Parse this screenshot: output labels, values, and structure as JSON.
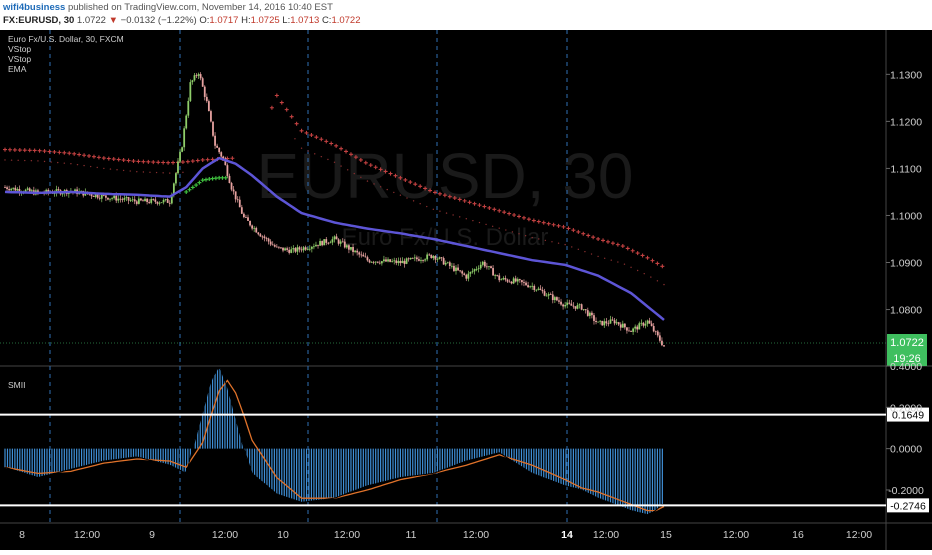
{
  "header": {
    "user": "wifi4business",
    "published": "published on TradingView.com, November 14, 2016 10:40 EST",
    "symbol": "FX:EURUSD, 30",
    "last": "1.0722",
    "arrow": "▼",
    "change": "−0.0132 (−1.22%)",
    "open_label": "O:",
    "open": "1.0717",
    "high_label": "H:",
    "high": "1.0725",
    "low_label": "L:",
    "low": "1.0713",
    "close_label": "C:",
    "close": "1.0722"
  },
  "legend": {
    "title": "Euro Fx/U.S. Dollar, 30, FXCM",
    "items": [
      "VStop",
      "VStop",
      "EMA"
    ]
  },
  "oscillator": {
    "name": "SMII"
  },
  "watermark": {
    "symbol": "EURUSD, 30",
    "desc": "Euro Fx/U.S. Dollar"
  },
  "colors": {
    "background": "#000000",
    "up_candle": "#8fce6a",
    "down_candle": "#e7a2a0",
    "ema": "#5d55d6",
    "vstop_red": "#c24141",
    "vstop_green": "#3fbf3f",
    "histogram": "#3f8fd6",
    "signal": "#e0722a",
    "current_price_bg": "#3fbf5f"
  },
  "chart_data": [
    {
      "type": "line",
      "name": "main-price",
      "x_ticks": [
        "8",
        "12:00",
        "9",
        "12:00",
        "12:00",
        "10",
        "12:00",
        "11",
        "12:00",
        "14",
        "12:00",
        "15",
        "12:00",
        "16",
        "12:00"
      ],
      "y_ticks": [
        "1.1300",
        "1.1200",
        "1.1100",
        "1.1000",
        "1.0900",
        "1.0800"
      ],
      "ylim": [
        1.068,
        1.139
      ],
      "current_price": "1.0722",
      "countdown": "19:26",
      "grid": false,
      "series": [
        {
          "name": "EMA",
          "x": [
            0,
            8,
            16,
            24,
            32,
            40,
            44,
            48,
            52,
            56,
            60,
            66,
            72,
            80,
            88,
            96,
            104,
            112,
            120,
            128,
            136,
            144,
            152,
            160
          ],
          "values": [
            1.105,
            1.1048,
            1.105,
            1.1046,
            1.1044,
            1.104,
            1.106,
            1.11,
            1.1122,
            1.111,
            1.1085,
            1.104,
            1.1005,
            1.0985,
            1.0972,
            1.0962,
            1.095,
            1.0935,
            1.092,
            1.0905,
            1.0895,
            1.0872,
            1.0835,
            1.0778
          ]
        },
        {
          "name": "price",
          "x": [
            0,
            8,
            16,
            24,
            32,
            40,
            43,
            45,
            47,
            49,
            51,
            53,
            55,
            58,
            62,
            66,
            70,
            74,
            80,
            88,
            96,
            104,
            112,
            116,
            120,
            124,
            128,
            132,
            136,
            140,
            144,
            148,
            152,
            156,
            160
          ],
          "values": [
            1.106,
            1.1048,
            1.1052,
            1.104,
            1.103,
            1.103,
            1.115,
            1.128,
            1.1305,
            1.124,
            1.115,
            1.112,
            1.106,
            1.0995,
            1.096,
            1.093,
            1.0925,
            1.0935,
            1.095,
            1.0905,
            1.09,
            1.0915,
            1.087,
            1.09,
            1.0865,
            1.086,
            1.085,
            1.083,
            1.081,
            1.0805,
            1.077,
            1.0775,
            1.0755,
            1.0775,
            1.0722
          ]
        },
        {
          "name": "VStop (upper)",
          "x": [
            0,
            8,
            16,
            24,
            32,
            40,
            44,
            48,
            52,
            56,
            60,
            66,
            72,
            80,
            88,
            96,
            104,
            112,
            120,
            128,
            136,
            144,
            150,
            156,
            160
          ],
          "values": [
            1.114,
            1.1138,
            1.1132,
            1.1122,
            1.1115,
            1.1112,
            1.1114,
            1.1118,
            1.112,
            1.1122,
            1.1125,
            1.1255,
            1.118,
            1.115,
            1.111,
            1.108,
            1.105,
            1.103,
            1.101,
            1.099,
            1.0975,
            1.095,
            1.0935,
            1.091,
            1.089
          ]
        },
        {
          "name": "VStop (lower)",
          "x": [
            44,
            46,
            48,
            50,
            52,
            54
          ],
          "values": [
            1.105,
            1.1062,
            1.1075,
            1.1078,
            1.108,
            1.108
          ]
        }
      ]
    },
    {
      "type": "bar",
      "name": "SMII",
      "y_ticks": [
        "0.4000",
        "0.2000",
        "0.0000",
        "-0.2000"
      ],
      "ylim": [
        -0.36,
        0.4
      ],
      "labels": [
        "0.1649",
        "-0.2746"
      ],
      "levels": [
        0.1649,
        -0.2746
      ],
      "series": [
        {
          "name": "SMII",
          "x": [
            0,
            8,
            16,
            24,
            32,
            40,
            44,
            48,
            50,
            52,
            54,
            56,
            58,
            60,
            66,
            72,
            80,
            88,
            96,
            104,
            112,
            120,
            128,
            136,
            140,
            144,
            148,
            152,
            156,
            158,
            160
          ],
          "values": [
            -0.09,
            -0.14,
            -0.1,
            -0.06,
            -0.04,
            -0.08,
            -0.12,
            0.18,
            0.33,
            0.4,
            0.3,
            0.15,
            0.0,
            -0.12,
            -0.22,
            -0.26,
            -0.24,
            -0.18,
            -0.14,
            -0.12,
            -0.06,
            -0.02,
            -0.12,
            -0.18,
            -0.2,
            -0.24,
            -0.27,
            -0.3,
            -0.32,
            -0.3,
            -0.26
          ]
        },
        {
          "name": "Signal",
          "x": [
            0,
            8,
            16,
            24,
            32,
            40,
            44,
            48,
            50,
            52,
            54,
            56,
            58,
            60,
            66,
            72,
            80,
            88,
            96,
            104,
            112,
            120,
            128,
            136,
            140,
            144,
            148,
            152,
            156,
            158,
            160
          ],
          "values": [
            -0.09,
            -0.12,
            -0.11,
            -0.07,
            -0.05,
            -0.06,
            -0.09,
            0.03,
            0.16,
            0.28,
            0.33,
            0.27,
            0.16,
            0.04,
            -0.14,
            -0.24,
            -0.24,
            -0.2,
            -0.15,
            -0.12,
            -0.08,
            -0.03,
            -0.08,
            -0.15,
            -0.19,
            -0.21,
            -0.24,
            -0.27,
            -0.3,
            -0.3,
            -0.28
          ]
        }
      ]
    }
  ]
}
